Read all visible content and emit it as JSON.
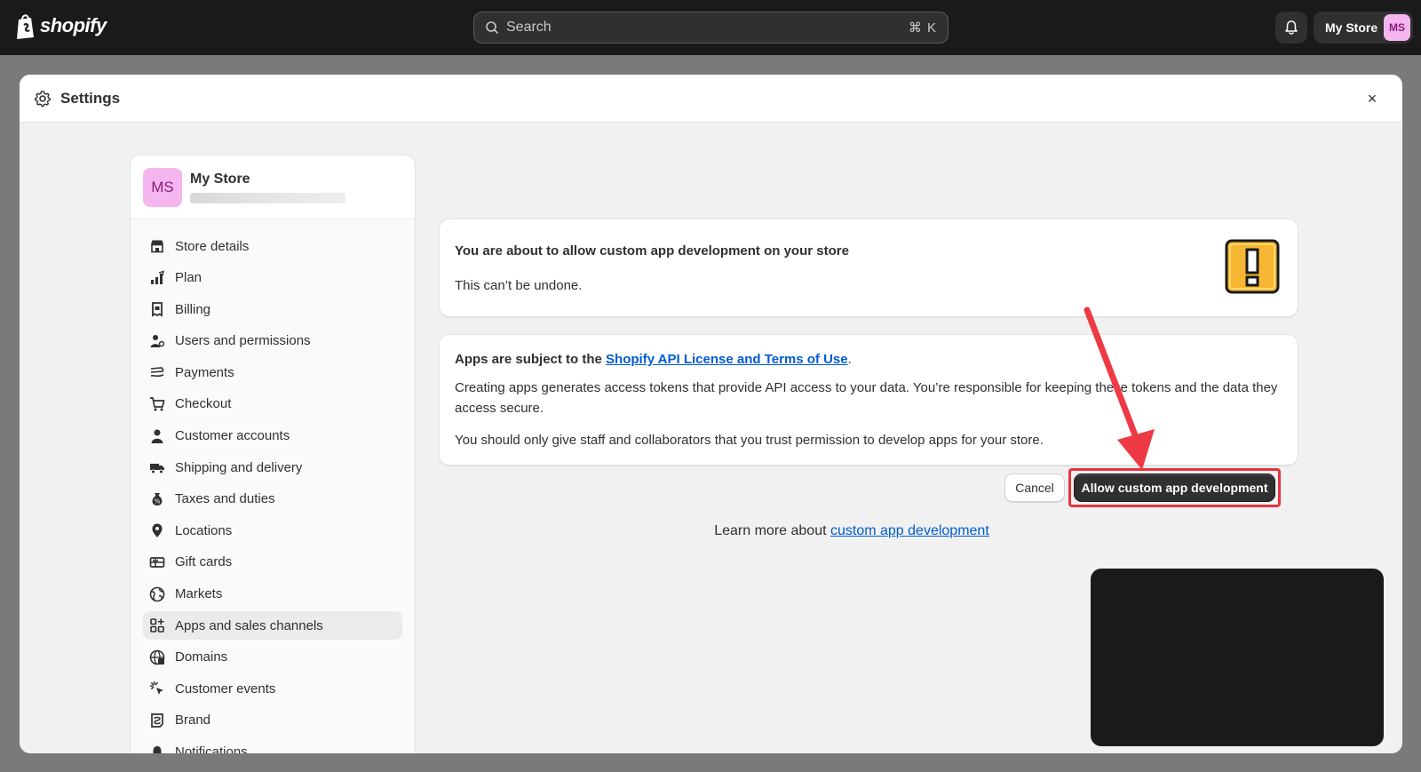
{
  "topbar": {
    "logo_text": "shopify",
    "search_placeholder": "Search",
    "search_shortcut": "⌘ K",
    "store_name": "My Store",
    "store_initials": "MS"
  },
  "modal": {
    "title": "Settings",
    "close_label": "×"
  },
  "sidebar": {
    "store_initials": "MS",
    "store_name": "My Store",
    "items": [
      {
        "label": "Store details",
        "icon": "store-icon"
      },
      {
        "label": "Plan",
        "icon": "plan-icon"
      },
      {
        "label": "Billing",
        "icon": "billing-icon"
      },
      {
        "label": "Users and permissions",
        "icon": "users-icon"
      },
      {
        "label": "Payments",
        "icon": "payments-icon"
      },
      {
        "label": "Checkout",
        "icon": "cart-icon"
      },
      {
        "label": "Customer accounts",
        "icon": "person-icon"
      },
      {
        "label": "Shipping and delivery",
        "icon": "truck-icon"
      },
      {
        "label": "Taxes and duties",
        "icon": "tax-icon"
      },
      {
        "label": "Locations",
        "icon": "location-icon"
      },
      {
        "label": "Gift cards",
        "icon": "gift-card-icon"
      },
      {
        "label": "Markets",
        "icon": "globe-icon"
      },
      {
        "label": "Apps and sales channels",
        "icon": "apps-icon",
        "active": true
      },
      {
        "label": "Domains",
        "icon": "domain-icon"
      },
      {
        "label": "Customer events",
        "icon": "cursor-icon"
      },
      {
        "label": "Brand",
        "icon": "brand-icon"
      },
      {
        "label": "Notifications",
        "icon": "bell-icon"
      }
    ]
  },
  "warning_card": {
    "title": "You are about to allow custom app development on your store",
    "subtitle": "This can’t be undone.",
    "icon": "exclamation-icon"
  },
  "terms_card": {
    "head_prefix": "Apps are subject to the ",
    "head_link": "Shopify API License and Terms of Use",
    "head_suffix": ".",
    "paragraph1": "Creating apps generates access tokens that provide API access to your data. You’re responsible for keeping these tokens and the data they access secure.",
    "paragraph2": "You should only give staff and collaborators that you trust permission to develop apps for your store."
  },
  "actions": {
    "cancel_label": "Cancel",
    "allow_label": "Allow custom app development"
  },
  "learn_more": {
    "prefix": "Learn more about ",
    "link": "custom app development"
  },
  "colors": {
    "topbar_bg": "#1a1a1a",
    "link": "#005bd3",
    "primary_button": "#303030",
    "highlight": "#e8333f",
    "warning_icon": "#f6b732",
    "avatar_bg": "#f5b6f0"
  }
}
